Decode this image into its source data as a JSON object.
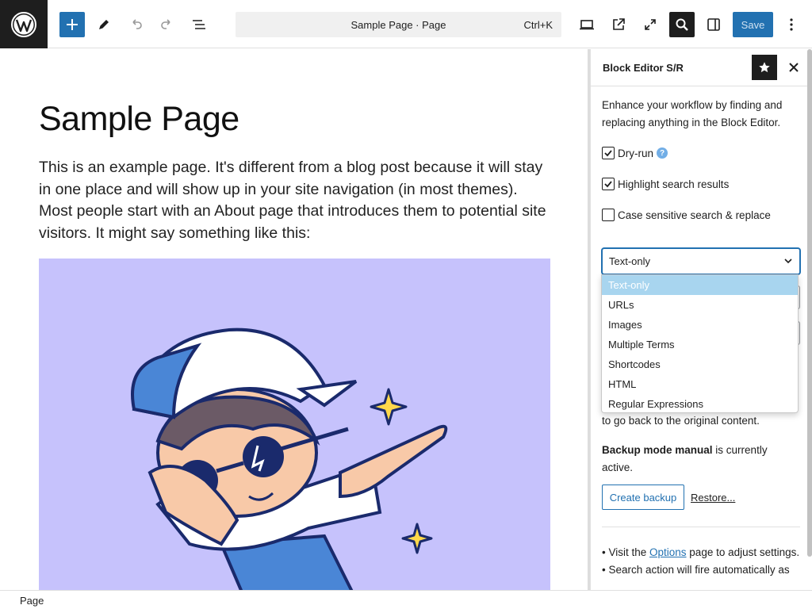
{
  "toolbar": {
    "document_title": "Sample Page · Page",
    "shortcut": "Ctrl+K",
    "save_label": "Save"
  },
  "post": {
    "title": "Sample Page",
    "paragraph": "This is an example page. It's different from a blog post because it will stay in one place and will show up in your site navigation (in most themes). Most people start with an About page that introduces them to potential site visitors. It might say something like this:"
  },
  "sidebar": {
    "title": "Block Editor S/R",
    "intro": "Enhance your workflow by finding and replacing anything in the Block Editor.",
    "options": [
      {
        "label": "Dry-run",
        "checked": true
      },
      {
        "label": "Highlight search results",
        "checked": true
      },
      {
        "label": "Case sensitive search & replace",
        "checked": false
      }
    ],
    "select_value": "Text-only",
    "backup_tail": "to go back to the original content.",
    "backup_mode_bold": "Backup mode manual",
    "backup_mode_rest": " is currently active.",
    "create_backup": "Create backup",
    "restore": "Restore...",
    "notes_1_pre": "• Visit the ",
    "notes_1_link": "Options",
    "notes_1_post": " page to adjust settings.",
    "notes_2": "• Search action will fire automatically as"
  },
  "dropdown": {
    "options": [
      "Text-only",
      "URLs",
      "Images",
      "Multiple Terms",
      "Shortcodes",
      "HTML",
      "Regular Expressions"
    ],
    "selected": "Text-only"
  },
  "footer": {
    "breadcrumb": "Page"
  },
  "colors": {
    "accent": "#2271b1",
    "image_bg": "#c6c2fc",
    "dark": "#1e1e1e"
  }
}
